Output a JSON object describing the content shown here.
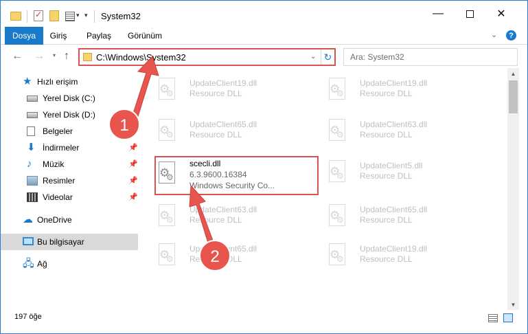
{
  "window": {
    "title": "System32",
    "buttons": {
      "minimize": "—",
      "close": "✕"
    }
  },
  "ribbon": {
    "tabs": [
      "Dosya",
      "Giriş",
      "Paylaş",
      "Görünüm"
    ],
    "help": "?"
  },
  "address": {
    "path": "C:\\Windows\\System32",
    "search_placeholder": "Ara: System32"
  },
  "sidebar": {
    "items": [
      {
        "label": "Hızlı erişim",
        "icon": "star-icon"
      },
      {
        "label": "Yerel Disk (C:)",
        "icon": "drive-icon"
      },
      {
        "label": "Yerel Disk (D:)",
        "icon": "drive-icon"
      },
      {
        "label": "Belgeler",
        "icon": "document-icon"
      },
      {
        "label": "İndirmeler",
        "icon": "download-icon",
        "pinned": true
      },
      {
        "label": "Müzik",
        "icon": "music-icon",
        "pinned": true
      },
      {
        "label": "Resimler",
        "icon": "pictures-icon",
        "pinned": true
      },
      {
        "label": "Videolar",
        "icon": "video-icon",
        "pinned": true
      },
      {
        "label": "OneDrive",
        "icon": "onedrive-icon"
      },
      {
        "label": "Bu bilgisayar",
        "icon": "computer-icon",
        "selected": true
      },
      {
        "label": "Ağ",
        "icon": "network-icon"
      }
    ]
  },
  "files": {
    "left": [
      {
        "name": "UpdateClient19.dll",
        "type": "Resource DLL"
      },
      {
        "name": "UpdateClient65.dll",
        "type": "Resource DLL"
      },
      {
        "name": "scecli.dll",
        "version": "6.3.9600.16384",
        "description": "Windows Security Co..."
      },
      {
        "name": "UpdateClient63.dll",
        "type": "Resource DLL"
      },
      {
        "name": "UpdateClient65.dll",
        "type": "Resource DLL"
      }
    ],
    "right": [
      {
        "name": "UpdateClient19.dll",
        "type": "Resource DLL"
      },
      {
        "name": "UpdateClient63.dll",
        "type": "Resource DLL"
      },
      {
        "name": "UpdateClient5.dll",
        "type": "Resource DLL"
      },
      {
        "name": "UpdateClient65.dll",
        "type": "Resource DLL"
      },
      {
        "name": "UpdateClient19.dll",
        "type": "Resource DLL"
      }
    ]
  },
  "status": {
    "count": "197 öğe"
  },
  "annotations": {
    "step1": "1",
    "step2": "2"
  },
  "colors": {
    "accent": "#1979ca",
    "highlight_box": "#d9534f",
    "arrow": "#e8554e"
  }
}
